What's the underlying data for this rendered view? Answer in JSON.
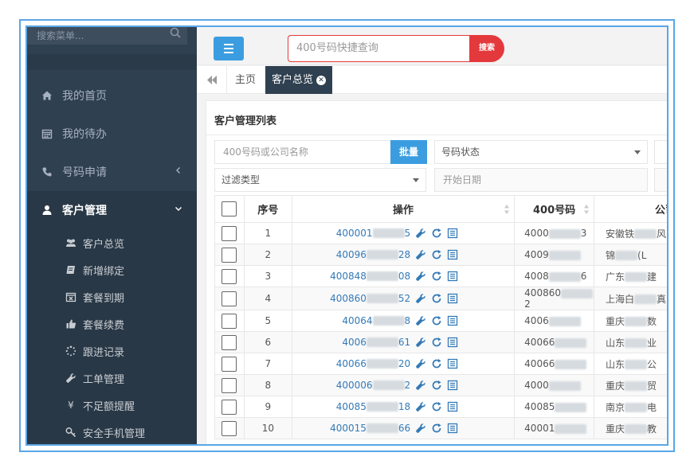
{
  "sidebar": {
    "search_placeholder": "搜索菜单...",
    "items": [
      {
        "label": "我的首页",
        "icon": "home-icon"
      },
      {
        "label": "我的待办",
        "icon": "calendar-icon"
      },
      {
        "label": "号码申请",
        "icon": "phone-icon"
      },
      {
        "label": "客户管理",
        "icon": "user-icon"
      }
    ],
    "submenu": [
      {
        "label": "客户总览",
        "icon": "users-icon"
      },
      {
        "label": "新增绑定",
        "icon": "book-icon"
      },
      {
        "label": "套餐到期",
        "icon": "calendar-x-icon"
      },
      {
        "label": "套餐续费",
        "icon": "thumbs-up-icon"
      },
      {
        "label": "跟进记录",
        "icon": "spinner-icon"
      },
      {
        "label": "工单管理",
        "icon": "wrench-icon"
      },
      {
        "label": "不足额提醒",
        "icon": "yen-icon"
      },
      {
        "label": "安全手机管理",
        "icon": "key-icon"
      }
    ]
  },
  "topbar": {
    "quick_placeholder": "400号码快捷查询",
    "quick_button": "搜索"
  },
  "tabs": {
    "home": "主页",
    "active": "客户总览"
  },
  "panel": {
    "title": "客户管理列表",
    "filter_number_placeholder": "400号码或公司名称",
    "batch_button": "批量",
    "status_select": "号码状态",
    "filter_type_select": "过滤类型",
    "start_date_placeholder": "开始日期"
  },
  "table": {
    "headers": {
      "index": "序号",
      "ops": "操作",
      "number": "400号码",
      "company": "公司"
    },
    "rows": [
      {
        "index": "1",
        "op_prefix": "400001",
        "op_suffix": "5",
        "num_prefix": "4000",
        "num_suffix": "3",
        "company_prefix": "安徽铁",
        "company_suffix": "风"
      },
      {
        "index": "2",
        "op_prefix": "40096",
        "op_suffix": "28",
        "num_prefix": "4009",
        "num_suffix": "",
        "company_prefix": "锦",
        "company_suffix": "(L"
      },
      {
        "index": "3",
        "op_prefix": "400848",
        "op_suffix": "08",
        "num_prefix": "4008",
        "num_suffix": "6",
        "company_prefix": "广东",
        "company_suffix": "建"
      },
      {
        "index": "4",
        "op_prefix": "400860",
        "op_suffix": "52",
        "num_prefix": "400860",
        "num_suffix": "2",
        "company_prefix": "上海白",
        "company_suffix": "真"
      },
      {
        "index": "5",
        "op_prefix": "40064",
        "op_suffix": "8",
        "num_prefix": "4006",
        "num_suffix": "",
        "company_prefix": "重庆",
        "company_suffix": "数"
      },
      {
        "index": "6",
        "op_prefix": "4006",
        "op_suffix": "61",
        "num_prefix": "40066",
        "num_suffix": "",
        "company_prefix": "山东",
        "company_suffix": "业"
      },
      {
        "index": "7",
        "op_prefix": "40066",
        "op_suffix": "20",
        "num_prefix": "40066",
        "num_suffix": "",
        "company_prefix": "山东",
        "company_suffix": "公"
      },
      {
        "index": "8",
        "op_prefix": "400006",
        "op_suffix": "2",
        "num_prefix": "4000",
        "num_suffix": "",
        "company_prefix": "重庆",
        "company_suffix": "贸"
      },
      {
        "index": "9",
        "op_prefix": "40085",
        "op_suffix": "18",
        "num_prefix": "40085",
        "num_suffix": "",
        "company_prefix": "南京",
        "company_suffix": "电"
      },
      {
        "index": "10",
        "op_prefix": "400015",
        "op_suffix": "66",
        "num_prefix": "40001",
        "num_suffix": "",
        "company_prefix": "重庆",
        "company_suffix": "教"
      }
    ]
  }
}
